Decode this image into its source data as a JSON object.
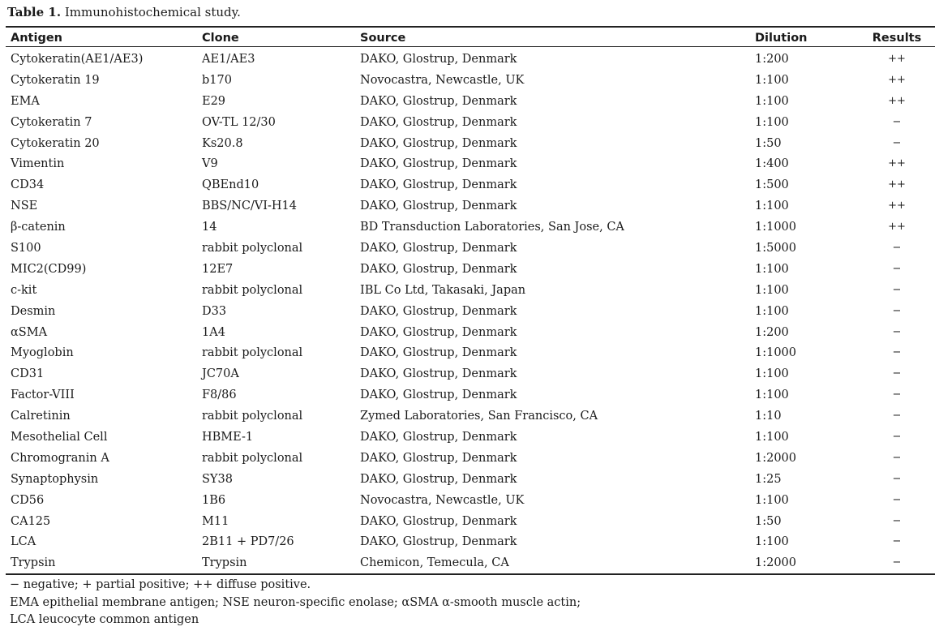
{
  "caption": {
    "label": "Table 1.",
    "text": " Immunohistochemical study."
  },
  "headers": [
    "Antigen",
    "Clone",
    "Source",
    "Dilution",
    "Results"
  ],
  "rows": [
    [
      "Cytokeratin(AE1/AE3)",
      "AE1/AE3",
      "DAKO, Glostrup, Denmark",
      "1:200",
      "++"
    ],
    [
      "Cytokeratin 19",
      "b170",
      "Novocastra, Newcastle, UK",
      "1:100",
      "++"
    ],
    [
      "EMA",
      "E29",
      "DAKO, Glostrup, Denmark",
      "1:100",
      "++"
    ],
    [
      "Cytokeratin 7",
      "OV-TL 12/30",
      "DAKO, Glostrup, Denmark",
      "1:100",
      "−"
    ],
    [
      "Cytokeratin 20",
      "Ks20.8",
      "DAKO, Glostrup, Denmark",
      "1:50",
      "−"
    ],
    [
      "Vimentin",
      "V9",
      "DAKO, Glostrup, Denmark",
      "1:400",
      "++"
    ],
    [
      "CD34",
      "QBEnd10",
      "DAKO, Glostrup, Denmark",
      "1:500",
      "++"
    ],
    [
      "NSE",
      "BBS/NC/VI-H14",
      "DAKO, Glostrup, Denmark",
      "1:100",
      "++"
    ],
    [
      "β-catenin",
      "14",
      "BD Transduction Laboratories, San Jose, CA",
      "1:1000",
      "++"
    ],
    [
      "S100",
      "rabbit polyclonal",
      "DAKO, Glostrup, Denmark",
      "1:5000",
      "−"
    ],
    [
      "MIC2(CD99)",
      "12E7",
      "DAKO, Glostrup, Denmark",
      "1:100",
      "−"
    ],
    [
      "c-kit",
      "rabbit polyclonal",
      "IBL Co Ltd, Takasaki, Japan",
      "1:100",
      "−"
    ],
    [
      "Desmin",
      "D33",
      "DAKO, Glostrup, Denmark",
      "1:100",
      "−"
    ],
    [
      "αSMA",
      "1A4",
      "DAKO, Glostrup, Denmark",
      "1:200",
      "−"
    ],
    [
      "Myoglobin",
      "rabbit polyclonal",
      "DAKO, Glostrup, Denmark",
      "1:1000",
      "−"
    ],
    [
      "CD31",
      "JC70A",
      "DAKO, Glostrup, Denmark",
      "1:100",
      "−"
    ],
    [
      "Factor-VIII",
      "F8/86",
      "DAKO, Glostrup, Denmark",
      "1:100",
      "−"
    ],
    [
      "Calretinin",
      "rabbit polyclonal",
      "Zymed Laboratories, San Francisco, CA",
      "1:10",
      "−"
    ],
    [
      "Mesothelial Cell",
      "HBME-1",
      "DAKO, Glostrup, Denmark",
      "1:100",
      "−"
    ],
    [
      "Chromogranin A",
      "rabbit polyclonal",
      "DAKO, Glostrup, Denmark",
      "1:2000",
      "−"
    ],
    [
      "Synaptophysin",
      "SY38",
      "DAKO, Glostrup, Denmark",
      "1:25",
      "−"
    ],
    [
      "CD56",
      "1B6",
      "Novocastra, Newcastle, UK",
      "1:100",
      "−"
    ],
    [
      "CA125",
      "M11",
      "DAKO, Glostrup, Denmark",
      "1:50",
      "−"
    ],
    [
      "LCA",
      "2B11 + PD7/26",
      "DAKO, Glostrup, Denmark",
      "1:100",
      "−"
    ],
    [
      "Trypsin",
      "Trypsin",
      "Chemicon, Temecula, CA",
      "1:2000",
      "−"
    ]
  ],
  "footnotes": [
    "− negative; + partial positive; ++ diffuse positive.",
    "EMA epithelial membrane antigen; NSE neuron-specific enolase; αSMA α-smooth muscle actin;",
    "LCA leucocyte common antigen"
  ]
}
